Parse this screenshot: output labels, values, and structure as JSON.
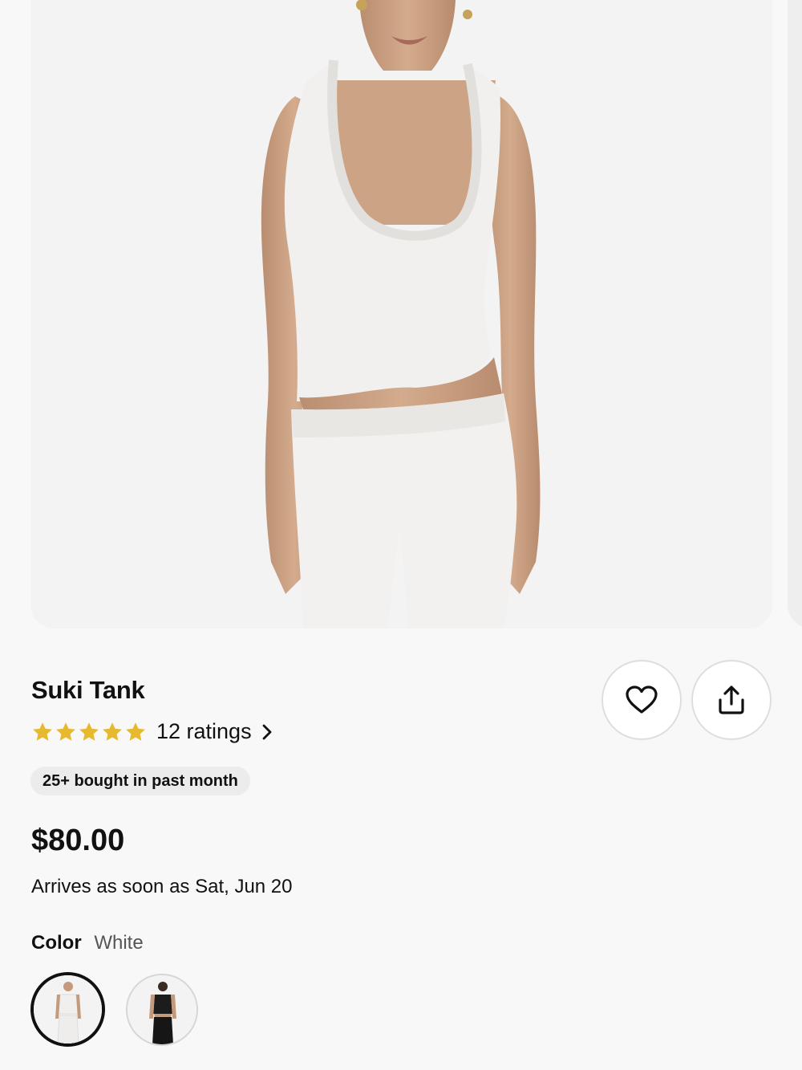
{
  "product": {
    "name": "Suki Tank",
    "rating_stars": 5,
    "ratings_text": "12 ratings",
    "badge": "25+ bought in past month",
    "price": "$80.00",
    "delivery": "Arrives as soon as Sat, Jun 20",
    "color_label": "Color",
    "color_value": "White"
  },
  "colors": {
    "star": "#e6b92f",
    "background": "#f9f8f8",
    "image_background": "#f4f3f3"
  },
  "icons": {
    "favorite": "heart-icon",
    "share": "share-icon",
    "ratings_chevron": "chevron-right-icon",
    "star": "star-icon"
  }
}
